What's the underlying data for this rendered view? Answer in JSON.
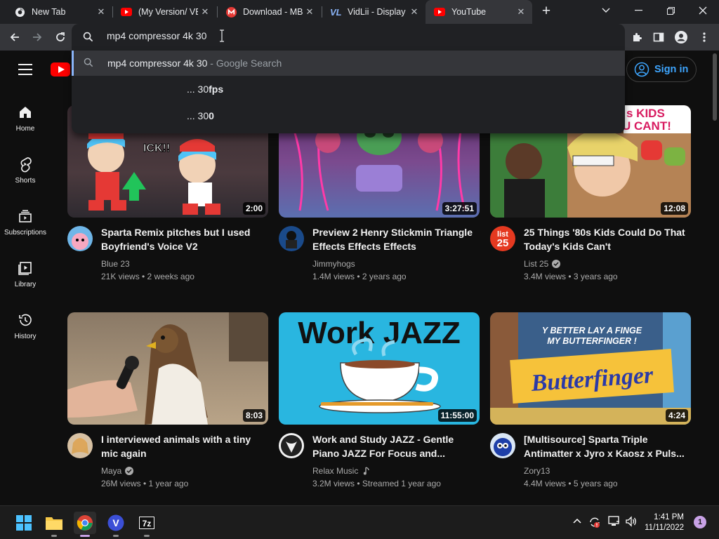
{
  "browser": {
    "tabs": [
      {
        "title": "New Tab",
        "favicon": "chrome-icon",
        "active": false
      },
      {
        "title": "(My Version/ VEGGIETALES",
        "favicon": "youtube-icon",
        "active": false
      },
      {
        "title": "Download - MB",
        "favicon": "mp4compress-icon",
        "active": false
      },
      {
        "title": "VidLii - Display",
        "favicon": "vidlii-icon",
        "active": false
      },
      {
        "title": "YouTube",
        "favicon": "youtube-icon",
        "active": true
      }
    ],
    "address_value": "mp4 compressor 4k 30",
    "suggestions": [
      {
        "text": "mp4 compressor 4k 30",
        "suffix": " - Google Search"
      },
      {
        "prefix": "... 30",
        "bold": "fps"
      },
      {
        "prefix": "... 30",
        "bold": "0"
      }
    ]
  },
  "youtube": {
    "signin_label": "Sign in",
    "sidebar": [
      {
        "label": "Home",
        "icon": "home-icon"
      },
      {
        "label": "Shorts",
        "icon": "shorts-icon"
      },
      {
        "label": "Subscriptions",
        "icon": "subscriptions-icon"
      },
      {
        "label": "Library",
        "icon": "library-icon"
      },
      {
        "label": "History",
        "icon": "history-icon"
      }
    ],
    "videos": [
      {
        "title": "Sparta Remix pitches but I used Boyfriend's Voice V2",
        "channel": "Blue 23",
        "verified": false,
        "music": false,
        "meta": "21K views • 2 weeks ago",
        "duration": "2:00"
      },
      {
        "title": "Preview 2 Henry Stickmin Triangle Effects Effects Effects",
        "channel": "Jimmyhogs",
        "verified": false,
        "music": false,
        "meta": "1.4M views • 2 years ago",
        "duration": "3:27:51"
      },
      {
        "title": "25 Things '80s Kids Could Do That Today's Kids Can't",
        "channel": "List 25",
        "verified": true,
        "music": false,
        "meta": "3.4M views • 3 years ago",
        "duration": "12:08",
        "thumb_text": [
          "s KIDS",
          "U CANT!"
        ],
        "avatar_text": [
          "list",
          "25"
        ]
      },
      {
        "title": "I interviewed animals with a tiny mic again",
        "channel": "Maya",
        "verified": true,
        "music": false,
        "meta": "26M views • 1 year ago",
        "duration": "8:03"
      },
      {
        "title": "Work and Study JAZZ - Gentle Piano JAZZ For Focus and...",
        "channel": "Relax Music",
        "verified": false,
        "music": true,
        "meta": "3.2M views • Streamed 1 year ago",
        "duration": "11:55:00",
        "thumb_text": [
          "Work JAZZ"
        ]
      },
      {
        "title": "[Multisource] Sparta Triple Antimatter x Jyro x Kaosz x Puls...",
        "channel": "Zory13",
        "verified": false,
        "music": false,
        "meta": "4.4M views • 5 years ago",
        "duration": "4:24",
        "thumb_text": [
          "Y BETTER LAY A FINGE",
          "MY BUTTERFINGER !",
          "Butterfinger"
        ]
      }
    ]
  },
  "taskbar": {
    "time": "1:41 PM",
    "date": "11/11/2022",
    "notification_count": "1"
  },
  "colors": {
    "page_bg": "#0f0f0f",
    "accent_blue": "#3ea6ff",
    "youtube_red": "#ff0000",
    "chrome_frame": "#202124"
  }
}
